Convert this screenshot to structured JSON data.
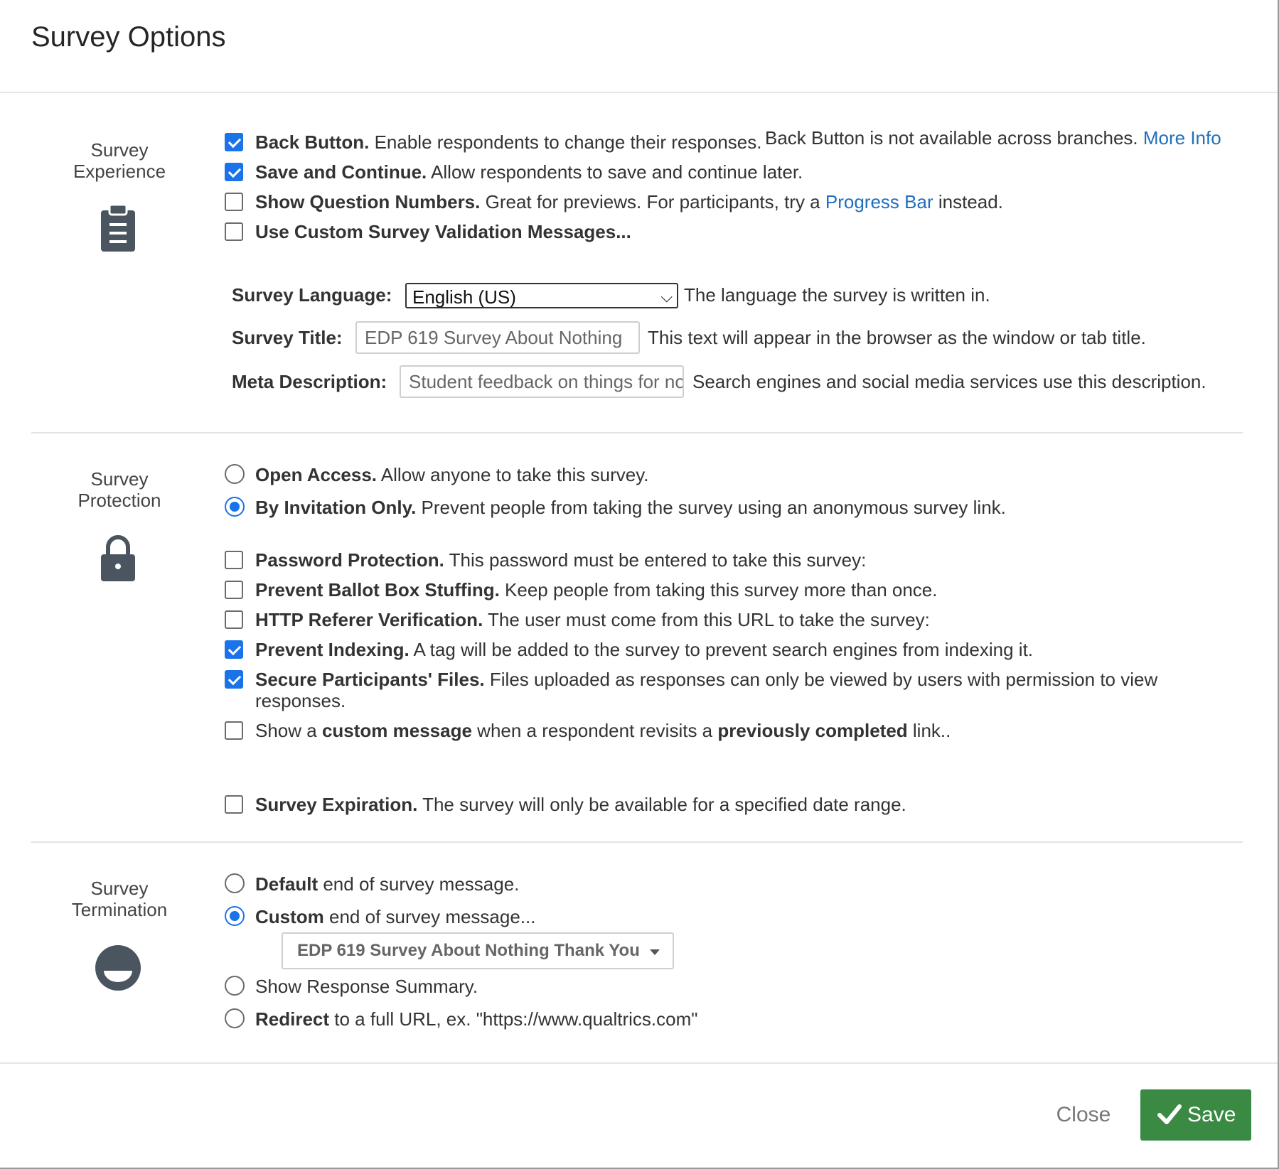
{
  "dialog": {
    "title": "Survey Options"
  },
  "sections": {
    "experience": {
      "label_line1": "Survey",
      "label_line2": "Experience",
      "icon": "clipboard-icon"
    },
    "protection": {
      "label_line1": "Survey",
      "label_line2": "Protection",
      "icon": "lock-icon"
    },
    "termination": {
      "label_line1": "Survey",
      "label_line2": "Termination",
      "icon": "smiley-icon"
    }
  },
  "experience": {
    "back_button": {
      "checked": true,
      "bold": "Back Button.",
      "text": " Enable respondents to change their responses.",
      "note": "Back Button is not available across branches.",
      "link": "More Info"
    },
    "save_continue": {
      "checked": true,
      "bold": "Save and Continue.",
      "text": " Allow respondents to save and continue later."
    },
    "question_numbers": {
      "checked": false,
      "bold": "Show Question Numbers.",
      "text": " Great for previews. For participants, try a ",
      "link": "Progress Bar",
      "text2": " instead."
    },
    "custom_validation": {
      "checked": false,
      "bold": "Use Custom Survey Validation Messages..."
    },
    "language": {
      "label": "Survey Language:",
      "value": "English (US)",
      "desc": "The language the survey is written in."
    },
    "survey_title": {
      "label": "Survey Title:",
      "value": "EDP 619 Survey About Nothing",
      "desc": "This text will appear in the browser as the window or tab title."
    },
    "meta_description": {
      "label": "Meta Description:",
      "value": "Student feedback on things for nothing",
      "desc": "Search engines and social media services use this description."
    }
  },
  "protection": {
    "open_access": {
      "selected": false,
      "bold": "Open Access.",
      "text": " Allow anyone to take this survey."
    },
    "by_invitation": {
      "selected": true,
      "bold": "By Invitation Only.",
      "text": " Prevent people from taking the survey using an anonymous survey link."
    },
    "password": {
      "checked": false,
      "bold": "Password Protection.",
      "text": " This password must be entered to take this survey:"
    },
    "ballot_box": {
      "checked": false,
      "bold": "Prevent Ballot Box Stuffing.",
      "text": " Keep people from taking this survey more than once."
    },
    "http_referer": {
      "checked": false,
      "bold": "HTTP Referer Verification.",
      "text": " The user must come from this URL to take the survey:"
    },
    "prevent_indexing": {
      "checked": true,
      "bold": "Prevent Indexing.",
      "text": " A tag will be added to the survey to prevent search engines from indexing it."
    },
    "secure_files": {
      "checked": true,
      "bold": "Secure Participants' Files.",
      "text": " Files uploaded as responses can only be viewed by users with permission to view responses."
    },
    "custom_message": {
      "checked": false,
      "t1": "Show a ",
      "b1": "custom message",
      "t2": " when a respondent revisits a ",
      "b2": "previously completed",
      "t3": " link.."
    },
    "expiration": {
      "checked": false,
      "bold": "Survey Expiration.",
      "text": " The survey will only be available for a specified date range."
    }
  },
  "termination": {
    "default_msg": {
      "selected": false,
      "bold": "Default",
      "text": " end of survey message."
    },
    "custom_msg": {
      "selected": true,
      "bold": "Custom",
      "text": " end of survey message..."
    },
    "custom_msg_select": "EDP 619 Survey About Nothing Thank You",
    "response_summary": {
      "selected": false,
      "text": "Show Response Summary."
    },
    "redirect": {
      "selected": false,
      "bold": "Redirect",
      "text": " to a full URL, ex. \"https://www.qualtrics.com\""
    }
  },
  "footer": {
    "close": "Close",
    "save": "Save"
  },
  "colors": {
    "accent": "#1a73e8",
    "link": "#1f6fbf",
    "save_button": "#3a8a44"
  }
}
